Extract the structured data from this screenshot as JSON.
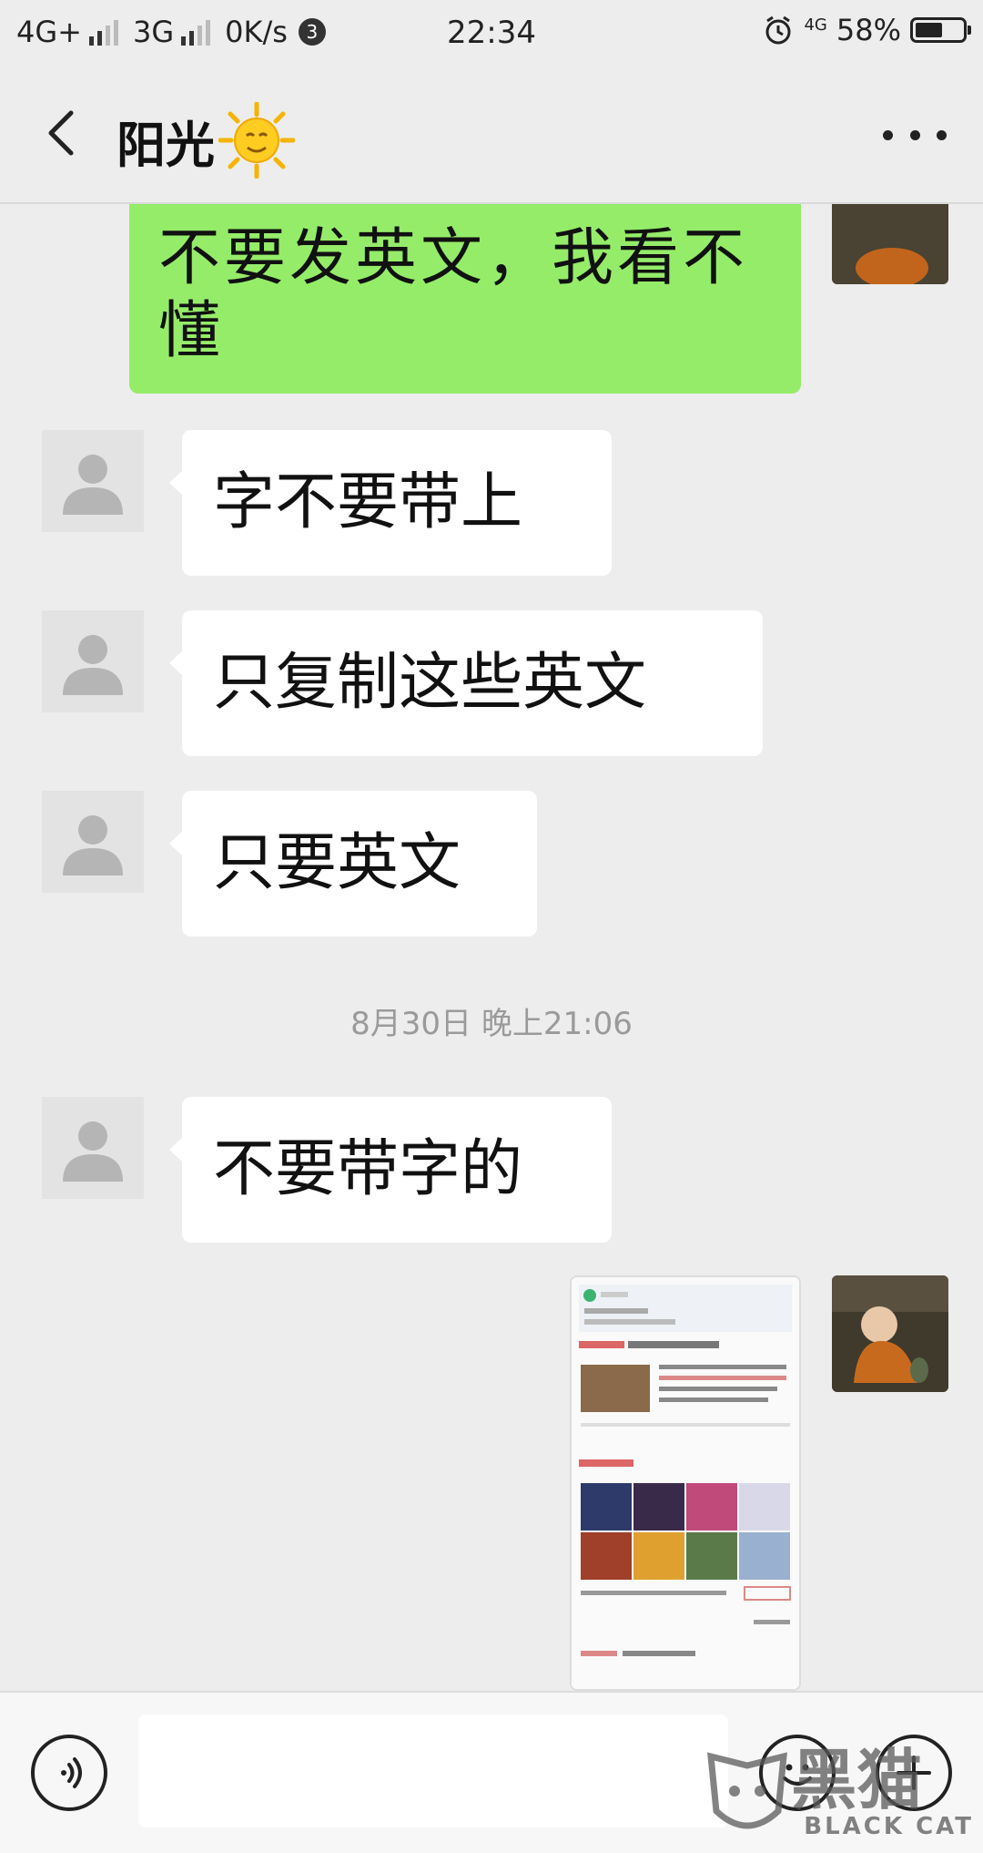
{
  "status_bar": {
    "net1": "4G+",
    "net2": "3G",
    "speed": "0K/s",
    "notif_count": "3",
    "time": "22:34",
    "net_small": "4G",
    "battery": "58%",
    "battery_level": 0.58
  },
  "header": {
    "title": "阳光",
    "title_emoji": "sun-with-face",
    "more_icon": "more-dots-icon",
    "back_icon": "back-chevron-icon"
  },
  "messages": [
    {
      "side": "right",
      "text": "不要发英文，我看不懂"
    },
    {
      "side": "left",
      "text": "字不要带上"
    },
    {
      "side": "left",
      "text": "只复制这些英文"
    },
    {
      "side": "left",
      "text": "只要英文"
    },
    {
      "side": "left",
      "text": "不要带字的"
    }
  ],
  "timestamp": "8月30日 晚上21:06",
  "colors": {
    "background": "#ededed",
    "sent_bubble": "#95ec69",
    "received_bubble": "#ffffff"
  },
  "input_bar": {
    "voice_icon": "voice-icon",
    "emoji_icon": "emoji-icon",
    "plus_icon": "plus-icon"
  },
  "watermark": {
    "cn": "黑猫",
    "en": "BLACK CAT"
  }
}
